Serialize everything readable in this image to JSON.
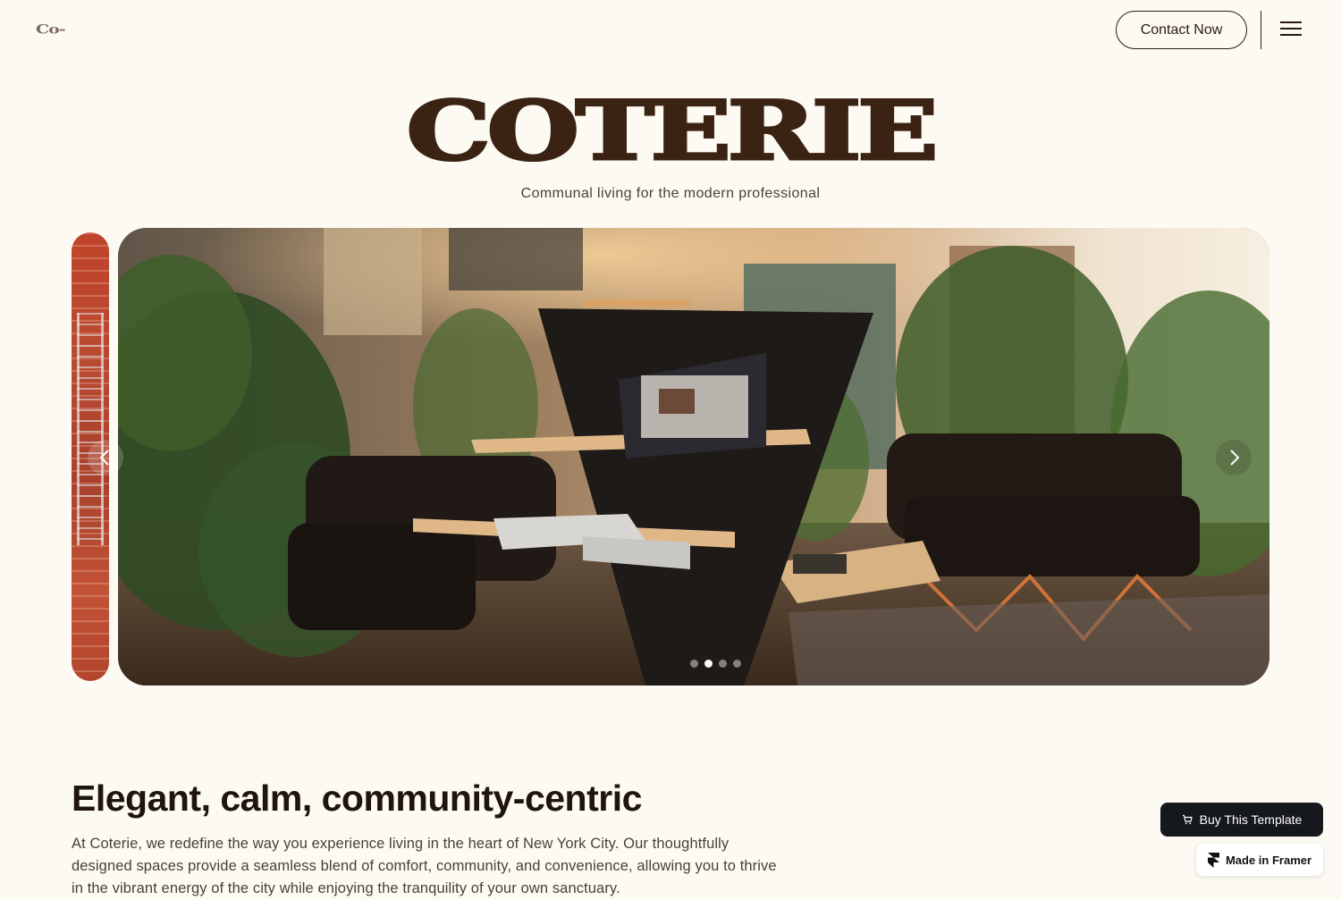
{
  "header": {
    "logo": "Co-",
    "contact_label": "Contact Now"
  },
  "hero": {
    "title": "COTERIE",
    "subtitle": "Communal living for the modern professional"
  },
  "carousel": {
    "slide_count": 4,
    "active_index": 1
  },
  "intro": {
    "title": "Elegant, calm, community-centric",
    "body": "At Coterie, we redefine the way you experience living in the heart of New York City. Our thoughtfully designed spaces provide a seamless blend of comfort, community, and convenience, allowing you to thrive in the vibrant energy of the city while enjoying the tranquility of your own sanctuary."
  },
  "badges": {
    "buy_label": "Buy This Template",
    "framer_label": "Made in Framer"
  },
  "icons": {
    "menu": "hamburger-menu-icon",
    "prev": "chevron-left-icon",
    "next": "chevron-right-icon",
    "cart": "cart-icon",
    "framer": "framer-logo-icon"
  },
  "colors": {
    "background": "#fdfaf4",
    "brand_brown": "#3b2313",
    "text_dark": "#1f1410",
    "badge_dark": "#15181d"
  }
}
